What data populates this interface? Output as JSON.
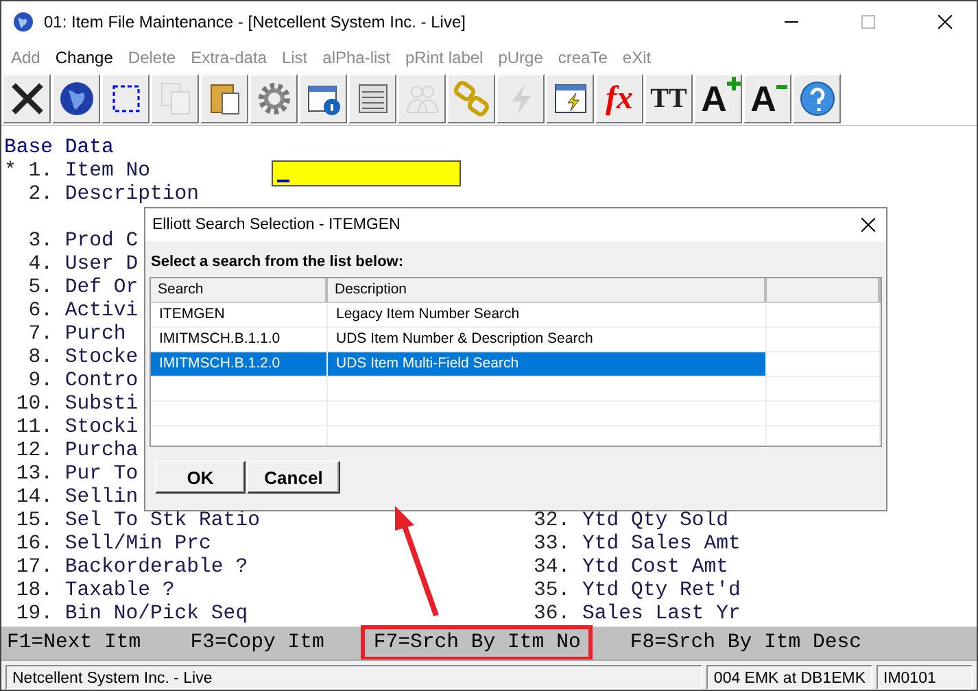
{
  "window": {
    "title": "01: Item File Maintenance - [Netcellent System Inc. - Live]"
  },
  "menu": [
    {
      "label": "Add",
      "disabled": true
    },
    {
      "label": "Change",
      "disabled": false
    },
    {
      "label": "Delete",
      "disabled": true
    },
    {
      "label": "Extra-data",
      "disabled": true
    },
    {
      "label": "List",
      "disabled": true
    },
    {
      "label": "alPha-list",
      "disabled": true
    },
    {
      "label": "pRint label",
      "disabled": true
    },
    {
      "label": "pUrge",
      "disabled": true
    },
    {
      "label": "creaTe",
      "disabled": true
    },
    {
      "label": "eXit",
      "disabled": true
    }
  ],
  "toolbar": [
    {
      "kind": "close",
      "disabled": false
    },
    {
      "kind": "globe",
      "disabled": false
    },
    {
      "kind": "select",
      "disabled": false
    },
    {
      "kind": "copy",
      "disabled": true
    },
    {
      "kind": "paste",
      "disabled": false
    },
    {
      "kind": "gear",
      "disabled": false
    },
    {
      "kind": "info",
      "disabled": false
    },
    {
      "kind": "list",
      "disabled": false
    },
    {
      "kind": "people",
      "disabled": true
    },
    {
      "kind": "chain",
      "disabled": false
    },
    {
      "kind": "lightning",
      "disabled": true
    },
    {
      "kind": "window-lightning",
      "disabled": false
    },
    {
      "kind": "fx",
      "glyph": "fx",
      "disabled": false
    },
    {
      "kind": "font",
      "glyph": "TT",
      "disabled": false
    },
    {
      "kind": "font-bigger",
      "glyph": "A",
      "disabled": false
    },
    {
      "kind": "font-smaller",
      "glyph": "A",
      "disabled": false
    },
    {
      "kind": "help",
      "disabled": false
    }
  ],
  "section": "Base Data",
  "field_groups": [
    [
      {
        "marker": "*",
        "number": "1.",
        "label": "Item No",
        "input": true
      },
      {
        "number": "2.",
        "label": "Description"
      }
    ],
    [
      {
        "number": "3.",
        "label": "Prod C"
      },
      {
        "number": "4.",
        "label": "User D"
      },
      {
        "number": "5.",
        "label": "Def Or"
      },
      {
        "number": "6.",
        "label": "Activi"
      },
      {
        "number": "7.",
        "label": "Purch"
      },
      {
        "number": "8.",
        "label": "Stocke"
      },
      {
        "number": "9.",
        "label": "Contro"
      },
      {
        "number": "10.",
        "label": "Substi"
      },
      {
        "number": "11.",
        "label": "Stocki"
      },
      {
        "number": "12.",
        "label": "Purcha"
      },
      {
        "number": "13.",
        "label": "Pur To"
      },
      {
        "number": "14.",
        "label": "Sellin"
      },
      {
        "number": "15.",
        "label": "Sel To Stk Ratio",
        "right": {
          "number": "32.",
          "label": "Ytd Qty Sold"
        }
      },
      {
        "number": "16.",
        "label": "Sell/Min Prc",
        "right": {
          "number": "33.",
          "label": "Ytd Sales Amt"
        }
      },
      {
        "number": "17.",
        "label": "Backorderable ?",
        "right": {
          "number": "34.",
          "label": "Ytd Cost Amt"
        }
      },
      {
        "number": "18.",
        "label": "Taxable ?",
        "right": {
          "number": "35.",
          "label": "Ytd Qty Ret'd"
        }
      },
      {
        "number": "19.",
        "label": "Bin No/Pick Seq",
        "right": {
          "number": "36.",
          "label": "Sales Last Yr"
        }
      }
    ]
  ],
  "dialog": {
    "title": "Elliott Search Selection - ITEMGEN",
    "prompt": "Select a search from the list below:",
    "columns": [
      "Search",
      "Description"
    ],
    "rows": [
      {
        "search": "ITEMGEN",
        "description": "Legacy Item Number Search",
        "selected": false
      },
      {
        "search": "IMITMSCH.B.1.1.0",
        "description": "UDS Item Number & Description Search",
        "selected": false
      },
      {
        "search": "IMITMSCH.B.1.2.0",
        "description": "UDS Item Multi-Field Search",
        "selected": true
      }
    ],
    "buttons": [
      "OK",
      "Cancel"
    ]
  },
  "function_keys": [
    {
      "label": "F1=Next Itm",
      "highlighted": false
    },
    {
      "label": "F3=Copy Itm",
      "highlighted": false
    },
    {
      "label": "F7=Srch By Itm No",
      "highlighted": true
    },
    {
      "label": "F8=Srch By Itm Desc",
      "highlighted": false
    }
  ],
  "status_bar": [
    "Netcellent System Inc. - Live",
    "004 EMK at DB1EMK",
    "IM0101"
  ]
}
